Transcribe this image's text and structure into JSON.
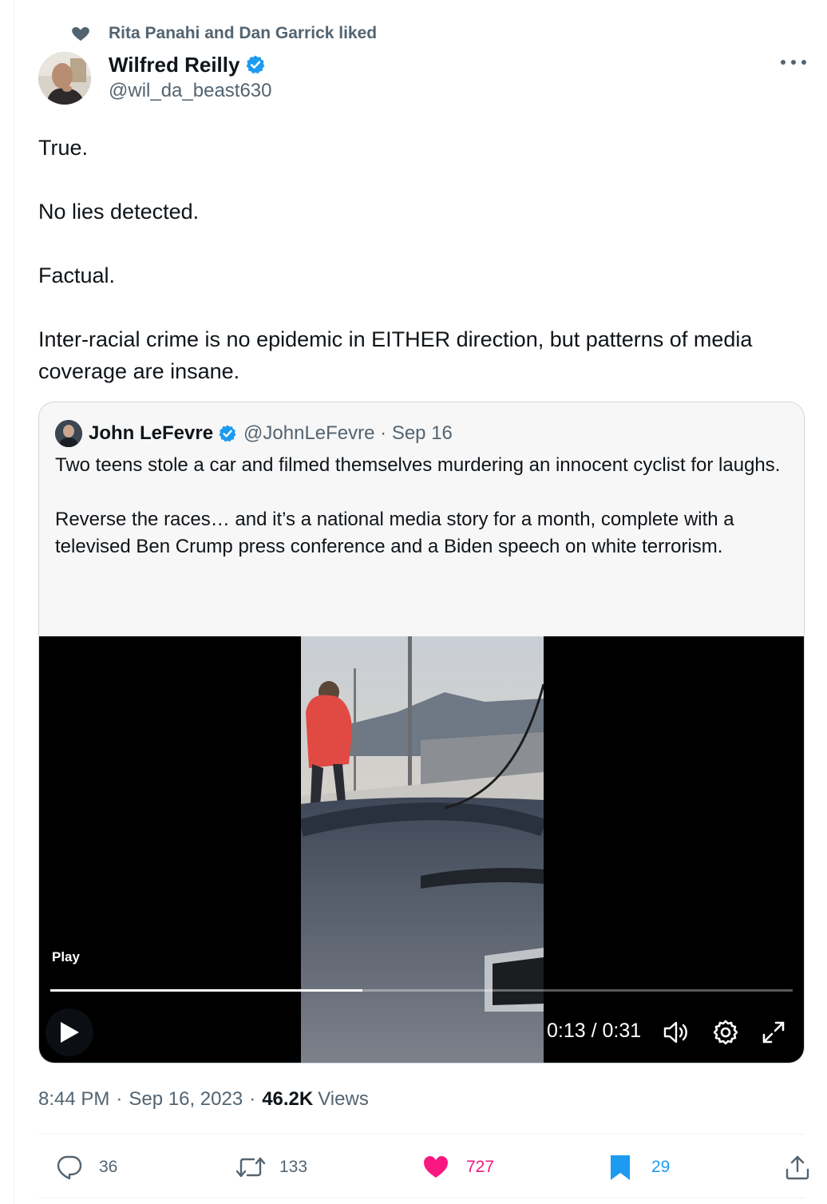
{
  "liked_by": "Rita Panahi and Dan Garrick liked",
  "author": {
    "name": "Wilfred Reilly",
    "handle": "@wil_da_beast630"
  },
  "body": [
    "True.",
    "No lies detected.",
    "Factual.",
    "Inter-racial crime is no epidemic in EITHER direction, but patterns of media coverage are insane."
  ],
  "quoted": {
    "name": "John LeFevre",
    "meta": "@JohnLeFevre · Sep 16",
    "text": [
      "Two teens stole a car and filmed themselves murdering an innocent cyclist for laughs.",
      "Reverse the races… and it’s a national media story for a month, complete with a televised Ben Crump press conference and a Biden speech on white terrorism."
    ],
    "video": {
      "play_label": "Play",
      "time": "0:13 / 0:31",
      "progress": 0.42
    }
  },
  "timestamp": {
    "time": "8:44 PM",
    "date": "Sep 16, 2023",
    "views_count": "46.2K",
    "views_label": "Views"
  },
  "actions": {
    "replies": "36",
    "reposts": "133",
    "likes": "727",
    "bookmarks": "29"
  },
  "colors": {
    "verified": "#1d9bf0",
    "like": "#f91880",
    "bookmark": "#1d9bf0",
    "muted": "#536471"
  }
}
